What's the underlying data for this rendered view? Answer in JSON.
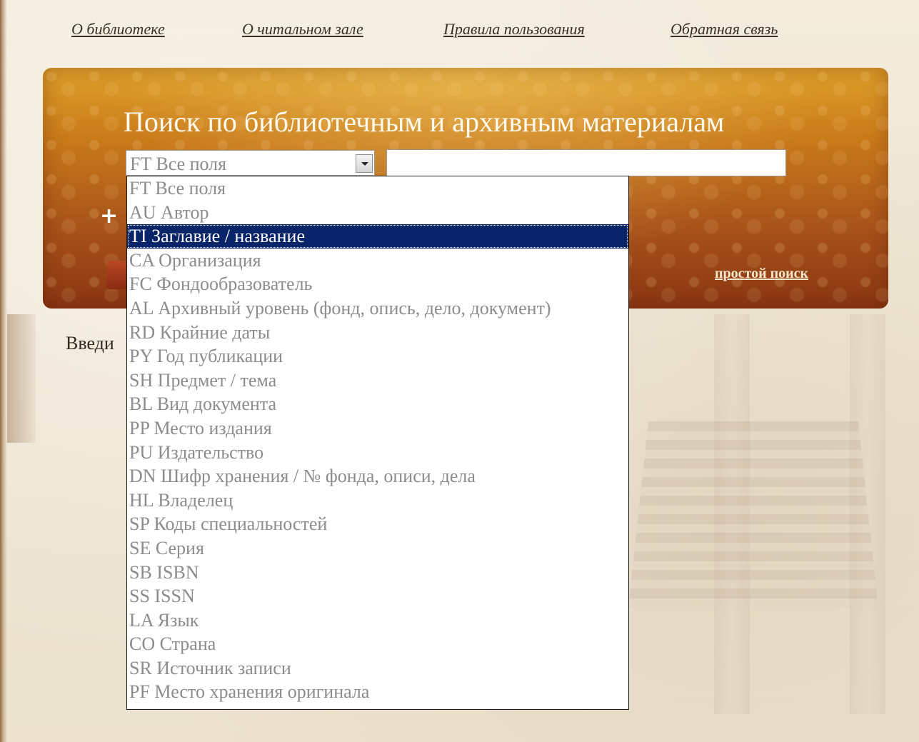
{
  "nav": {
    "links": [
      {
        "label": "О библиотеке"
      },
      {
        "label": "О читальном зале"
      },
      {
        "label": "Правила пользования"
      },
      {
        "label": "Обратная связь"
      }
    ]
  },
  "search": {
    "title": "Поиск по библиотечным и архивным материалам",
    "field_select_value": "FT Все поля",
    "query_value": "",
    "add_row_icon": "plus-icon",
    "simple_search_label": "простой поиск",
    "hint_visible": "Введи"
  },
  "dropdown": {
    "selected_index": 2,
    "options": [
      "FT Все поля",
      "AU Автор",
      "TI Заглавие / название",
      "CA Организация",
      "FC Фондообразователь",
      "AL Архивный уровень (фонд, опись, дело, документ)",
      "RD Крайние даты",
      "PY Год публикации",
      "SH Предмет / тема",
      "BL Вид документа",
      "PP Место издания",
      "PU Издательство",
      "DN Шифр хранения / № фонда, описи, дела",
      "HL Владелец",
      "SP Коды специальностей",
      "SE Серия",
      "SB ISBN",
      "SS ISSN",
      "LA Язык",
      "CO Страна",
      "SR Источник записи",
      "PF Место хранения оригинала"
    ]
  },
  "colors": {
    "panel_top": "#dfa12a",
    "panel_bottom": "#8a3612",
    "selected_bg": "#0a246a",
    "option_text": "#8c8c8c"
  }
}
